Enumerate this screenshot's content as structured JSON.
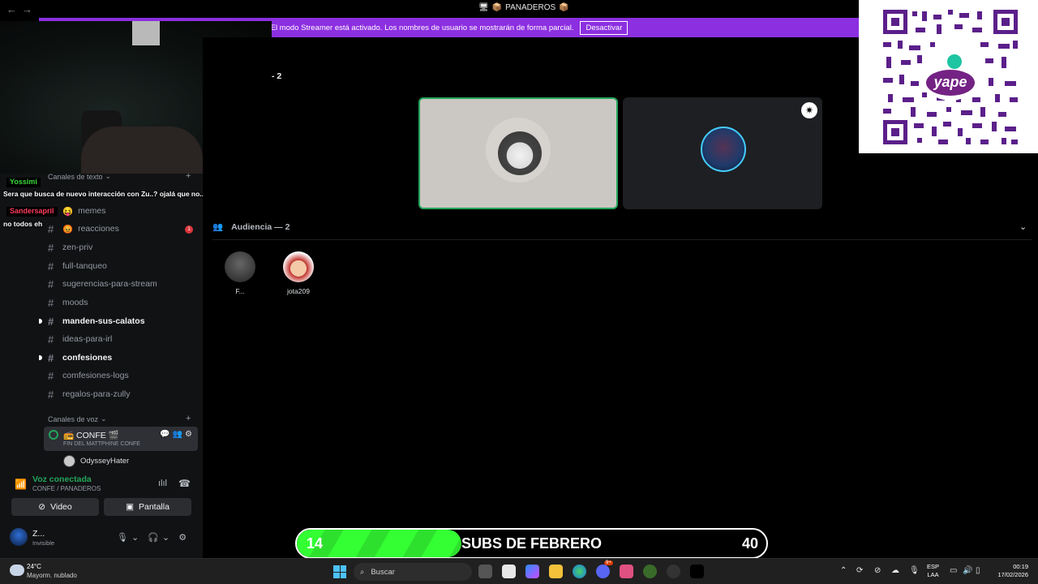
{
  "window": {
    "back_icon": "arrow-left-icon",
    "title": "PANADEROS"
  },
  "banner": {
    "text": "El modo Streamer está activado. Los nombres de usuario se mostrarán de forma parcial.",
    "button": "Desactivar"
  },
  "stage": {
    "count": "- 2",
    "audience_label": "Audiencia — 2",
    "audience": [
      {
        "name": "F..."
      },
      {
        "name": "jota209"
      }
    ]
  },
  "sidebar": {
    "text_category": "Canales de texto",
    "voice_category": "Canales de voz",
    "channels": [
      {
        "name": "memes",
        "emoji": true
      },
      {
        "name": "reacciones",
        "emoji": true,
        "badge": "1"
      },
      {
        "name": "zen-priv"
      },
      {
        "name": "full-tanqueo"
      },
      {
        "name": "sugerencias-para-stream"
      },
      {
        "name": "moods"
      },
      {
        "name": "manden-sus-calatos",
        "unread": true
      },
      {
        "name": "ideas-para-irl"
      },
      {
        "name": "confesiones",
        "unread": true
      },
      {
        "name": "comfesiones-logs"
      },
      {
        "name": "regalos-para-zully"
      }
    ],
    "voice_channel": {
      "name": "CONFE",
      "subtitle": "FIN DEL MATTPHINE CONFE",
      "member": "OdysseyHater"
    }
  },
  "chat_overlay": [
    {
      "user": "Yossimi",
      "color": "#3ddc3d",
      "message": "Sera que busca de nuevo interacción con Zu..? ojalá que no.."
    },
    {
      "user": "Sandersapril",
      "color": "#ff3b5c",
      "message": "no todos eh"
    }
  ],
  "voice_panel": {
    "status": "Voz conectada",
    "location": "CONFE / PANADEROS",
    "video_label": "Video",
    "screen_label": "Pantalla"
  },
  "user": {
    "name": "Z...",
    "status": "Invisible"
  },
  "subs_goal": {
    "current": "14",
    "label": "SUBS DE FEBRERO",
    "target": "40",
    "progress_fraction": 0.35
  },
  "taskbar": {
    "temperature": "24°C",
    "condition": "Mayorm. nublado",
    "search_placeholder": "Buscar",
    "lang_top": "ESP",
    "lang_bottom": "LAA",
    "time": "00:19",
    "date": "17/02/2026",
    "discord_badge": "9+"
  },
  "colors": {
    "banner": "#8c2fe0",
    "online_green": "#23a55a",
    "goal_green": "#33ff33"
  }
}
